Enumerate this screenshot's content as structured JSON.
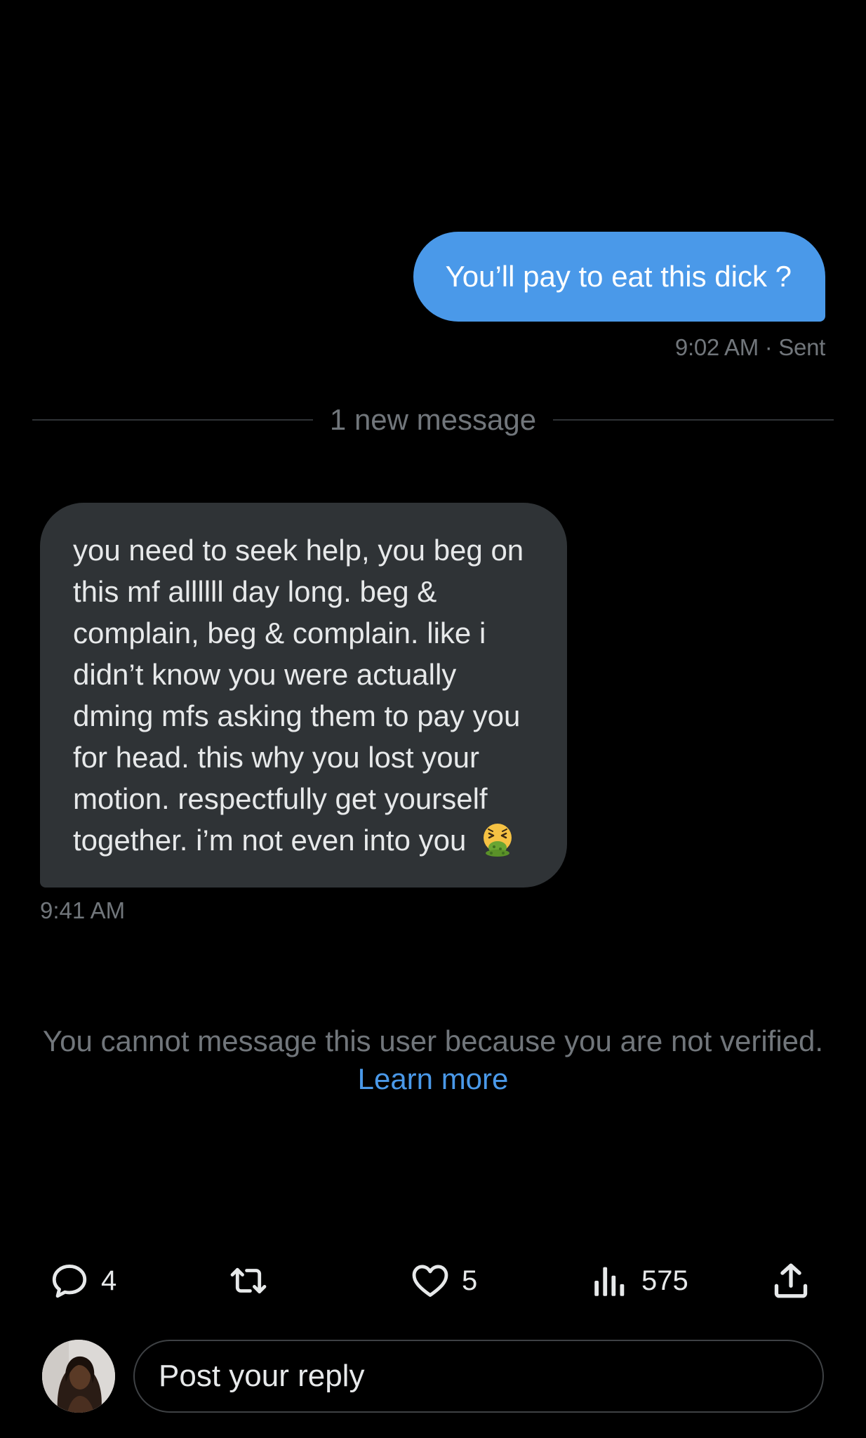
{
  "conversation": {
    "sent_message": {
      "text": "You’ll pay to eat this dick ?",
      "meta": "9:02 AM · Sent"
    },
    "divider_label": "1 new message",
    "received_message": {
      "text": "you need to seek help, you beg on this mf allllll day long. beg & complain, beg & complain. like i didn’t know you were actually dming mfs asking them to pay you for head. this why you lost your motion. respectfully get yourself together. i’m not even into you",
      "emoji": "vomiting-face-emoji",
      "meta": "9:41 AM"
    },
    "notice": {
      "text": "You cannot message this user because you are not verified.",
      "link_label": "Learn more"
    }
  },
  "action_bar": {
    "reply_icon": "speech-bubble-icon",
    "reply_count": "4",
    "repost_icon": "repost-arrows-icon",
    "like_icon": "heart-icon",
    "like_count": "5",
    "views_icon": "bar-chart-icon",
    "views_count": "575",
    "share_icon": "share-upload-icon"
  },
  "reply_bar": {
    "avatar": "user-avatar",
    "placeholder": "Post your reply"
  },
  "colors": {
    "background": "#000000",
    "sent_bubble": "#4a99e9",
    "received_bubble": "#2f3336",
    "muted_text": "#71767b",
    "link": "#4a99e9"
  }
}
